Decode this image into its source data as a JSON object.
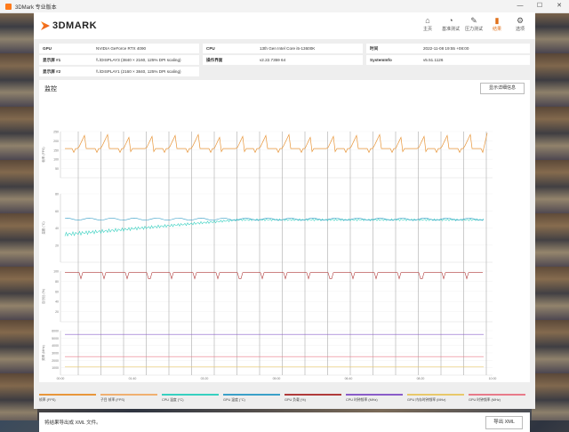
{
  "window": {
    "title": "3DMark 专业版本"
  },
  "nav": [
    {
      "label": "主页",
      "icon": "home-icon",
      "glyph": "⌂"
    },
    {
      "label": "基准测试",
      "icon": "gauge-icon",
      "glyph": "◔"
    },
    {
      "label": "压力测试",
      "icon": "stress-icon",
      "glyph": "✎"
    },
    {
      "label": "结果",
      "icon": "results-icon",
      "glyph": "▮",
      "active": true
    },
    {
      "label": "选项",
      "icon": "gear-icon",
      "glyph": "⚙"
    }
  ],
  "sysinfo": {
    "gpu_label": "GPU",
    "gpu_value": "NVIDIA GeForce RTX 4090",
    "disp1_label": "显示屏 #1",
    "disp1_value": "\\\\.\\DISPLAY3 (3840 × 2160, 125% DPI scaling)",
    "disp2_label": "显示屏 #2",
    "disp2_value": "\\\\.\\DISPLAY1 (2160 × 3840, 125% DPI scaling)",
    "cpu_label": "CPU",
    "cpu_value": "13th Gen Intel Core i5-13600K",
    "ui_label": "操作界面",
    "ui_value": "v2.22.7359 64",
    "time_label": "时间",
    "time_value": "2022-11-08 19:55 +08:00",
    "si_label": "SystemInfo",
    "si_value": "v5.51.1126"
  },
  "monitor": {
    "title": "监控",
    "detail_button": "显示详细信息"
  },
  "chart_data": {
    "type": "line",
    "x_ticks": [
      "00:00",
      "01:40",
      "03:20",
      "05:00",
      "06:40",
      "08:20",
      "10:00"
    ],
    "panels": [
      {
        "ylabel": "帧率 (FPS)",
        "ylim": [
          0,
          300
        ],
        "ticks": [
          "250",
          "200",
          "150",
          "100",
          "50"
        ]
      },
      {
        "ylabel": "温度 (°C)",
        "ylim": [
          0,
          100
        ],
        "ticks": [
          "80",
          "60",
          "40",
          "20"
        ]
      },
      {
        "ylabel": "百分比 (%)",
        "ylim": [
          0,
          100
        ],
        "ticks": [
          "100",
          "80",
          "60",
          "40",
          "20"
        ]
      },
      {
        "ylabel": "频率 (MHz)",
        "ylim": [
          0,
          6000
        ],
        "ticks": [
          "6000",
          "5000",
          "4000",
          "3000",
          "2000",
          "1000"
        ]
      }
    ],
    "series": [
      {
        "name": "帧率 (FPS)",
        "color": "#e8963a",
        "level": 190,
        "spike": 290
      },
      {
        "name": "CPU 温度 (°C)",
        "color": "#37d0c0",
        "level": 62
      },
      {
        "name": "GPU 温度 (°C)",
        "color": "#3aa0c8",
        "level": 63
      },
      {
        "name": "GPU 负载 (%)",
        "color": "#b03a3a",
        "level": 97
      },
      {
        "name": "CPU 时钟频率 (MHz)",
        "color": "#8a5cc8",
        "level": 5500
      },
      {
        "name": "GPU 内存时钟频率 (MHz)",
        "color": "#e87a8a",
        "level": 2500
      },
      {
        "name": "GPU 时钟频率 (MHz)",
        "color": "#e8c86a",
        "level": 1100
      }
    ]
  },
  "legend": [
    {
      "label": "帧率 (FPS)",
      "color": "#e8963a"
    },
    {
      "label": "子目 帧率 (FPS)",
      "color": "#f0b070"
    },
    {
      "label": "CPU 温度 (°C)",
      "color": "#37d0c0"
    },
    {
      "label": "GPU 温度 (°C)",
      "color": "#3aa0c8"
    },
    {
      "label": "GPU 负载 (%)",
      "color": "#b03a3a"
    },
    {
      "label": "CPU 时钟频率 (MHz)",
      "color": "#8a5cc8"
    },
    {
      "label": "GPU 内存时钟频率 (MHz)",
      "color": "#e8c86a"
    },
    {
      "label": "GPU 时钟频率 (MHz)",
      "color": "#e87a8a"
    }
  ],
  "footer": {
    "hint": "将结果导出成 XML 文件。",
    "export_button": "导出 XML"
  }
}
